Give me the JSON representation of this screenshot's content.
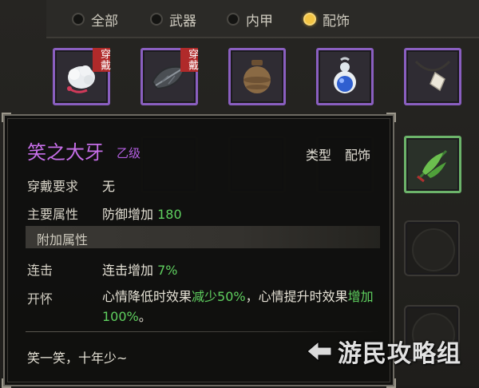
{
  "filters": [
    {
      "label": "全部",
      "selected": false
    },
    {
      "label": "武器",
      "selected": false
    },
    {
      "label": "内甲",
      "selected": false
    },
    {
      "label": "配饰",
      "selected": true
    }
  ],
  "slots": [
    {
      "icon": "cotton-charm-icon",
      "tag": "穿戴",
      "frame": "purple"
    },
    {
      "icon": "dark-leaf-charm-icon",
      "tag": "穿戴",
      "frame": "purple"
    },
    {
      "icon": "clay-jar-icon",
      "tag": "",
      "frame": "purple"
    },
    {
      "icon": "blue-gourd-icon",
      "tag": "",
      "frame": "purple"
    },
    {
      "icon": "tooth-necklace-icon",
      "tag": "",
      "frame": "purple"
    },
    {
      "icon": "herb-bundle-icon",
      "tag": "",
      "frame": "green"
    }
  ],
  "tooltip": {
    "name": "笑之大牙",
    "grade": "乙级",
    "type_label": "类型",
    "type_value": "配饰",
    "requirement_label": "穿戴要求",
    "requirement_value": "无",
    "main_attr_label": "主要属性",
    "main_attr_text": "防御增加",
    "main_attr_value": "180",
    "extra_section": "附加属性",
    "combo_label": "连击",
    "combo_text": "连击增加",
    "combo_value": "7%",
    "cheer_label": "开怀",
    "cheer_text_1": "心情降低时效果",
    "cheer_value_1": "减少50%",
    "cheer_text_2": "，心情提升时效果",
    "cheer_value_2": "增加100%",
    "cheer_text_3": "。",
    "flavor": "笑一笑，十年少~"
  },
  "watermark": "游民攻略组",
  "colors": {
    "legendary_purple": "#c66ee8",
    "bonus_green": "#5fd05f",
    "wear_tag": "#b02a2a"
  }
}
